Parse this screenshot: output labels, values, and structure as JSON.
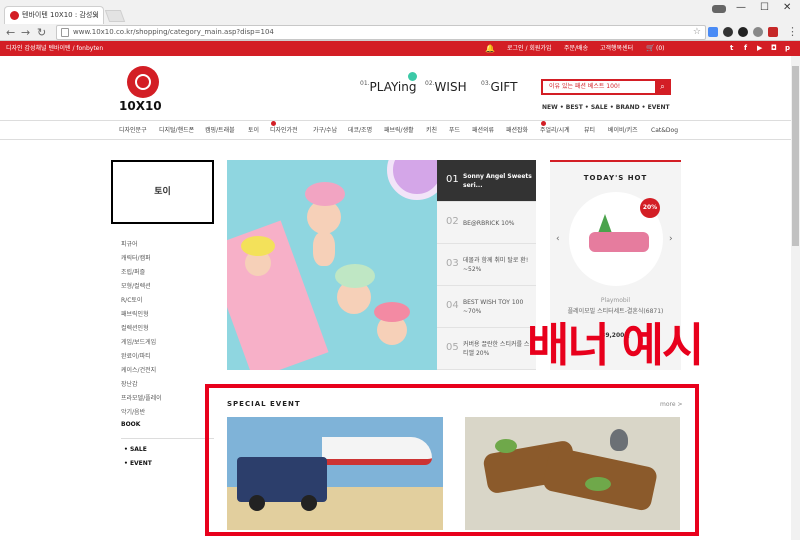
{
  "browser": {
    "tab_title": "텐바이텐 10X10 : 감성의",
    "tab_close": "×",
    "url": "www.10x10.co.kr/shopping/category_main.asp?disp=104",
    "win_min": "—",
    "win_max": "☐",
    "win_close": "✕",
    "back": "←",
    "forward": "→",
    "reload": "↻",
    "star": "☆",
    "menu": "⋮"
  },
  "topbar": {
    "tagline": "디자인 감성채널 텐바이텐 / fonbyten",
    "links": [
      "로그인 / 회원가입",
      "주문/배송",
      "고객행복센터"
    ],
    "cart": "(0)",
    "social": [
      "t",
      "f",
      "▶",
      "◘",
      "p"
    ]
  },
  "logo": {
    "text": "10X10"
  },
  "promo_nav": [
    {
      "num": "01.",
      "label": "PLAYing"
    },
    {
      "num": "02.",
      "label": "WISH"
    },
    {
      "num": "03.",
      "label": "GIFT"
    }
  ],
  "search": {
    "placeholder": "이유 있는 패션 베스트 100!",
    "icon": "search-icon"
  },
  "quick_links": "NEW • BEST • SALE • BRAND • EVENT",
  "categories": [
    "디자인문구",
    "디지털/핸드폰",
    "캠핑/트래블",
    "토이",
    "디자인가전",
    "가구/수납",
    "패브릭/생활",
    "데코/조명",
    "키친",
    "푸드",
    "패션의류",
    "패션잡화",
    "주얼리/시계",
    "뷰티",
    "베이비/키즈",
    "Cat&Dog"
  ],
  "sidebar": {
    "title": "토이",
    "items": [
      "피규어",
      "캐릭터/캠퍼",
      "조립/퍼즐",
      "모형/컬렉션",
      "R/C토이",
      "패브릭인형",
      "컬렉션인형",
      "게임/보드게임",
      "완료이/파티",
      "케이스/건전지",
      "장난감",
      "프라모델/플레이",
      "악기/음반",
      "BOOK"
    ],
    "bottom_items": [
      "SALE",
      "EVENT"
    ]
  },
  "banner_list": [
    {
      "num": "01",
      "text": "Sonny Angel Sweets seri...",
      "active": true
    },
    {
      "num": "02",
      "text": "BE@RBRICK 10%",
      "active": false
    },
    {
      "num": "03",
      "text": "데몰과 함께 취미 탈로 환! ~52%",
      "active": false
    },
    {
      "num": "04",
      "text": "BEST WISH TOY 100 ~70%",
      "active": false
    },
    {
      "num": "05",
      "text": "커버용 끌란한 스티커를 스티앨 20%",
      "active": false
    }
  ],
  "hot": {
    "title": "TODAY'S HOT",
    "badge": "20%",
    "brand": "Playmobil",
    "name": "플레이모빌 스티터세트-결혼식(6871)",
    "price": "39,200원",
    "prev": "‹",
    "next": "›"
  },
  "overlay_text": "배너 예시",
  "special_event": {
    "title": "SPECIAL EVENT",
    "more": "more >"
  },
  "colors": {
    "brand_red": "#d31e25",
    "annotation_red": "#e8001c"
  }
}
